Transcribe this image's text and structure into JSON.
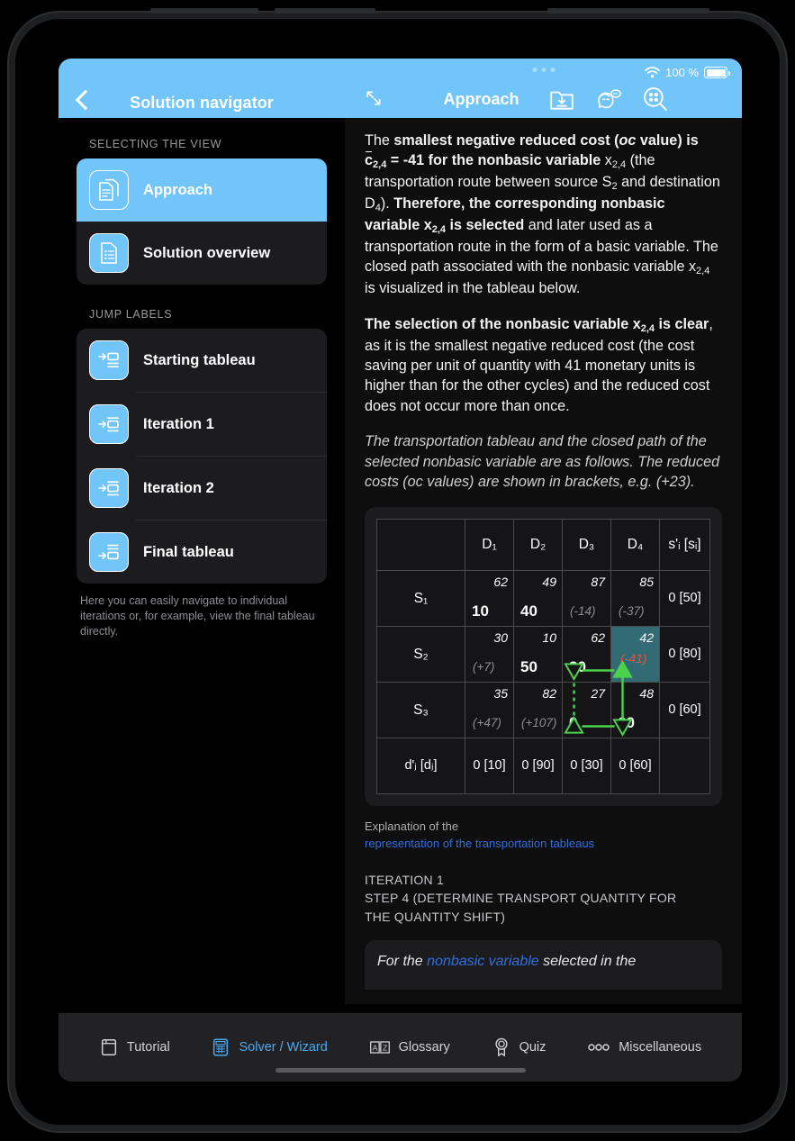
{
  "status": {
    "battery_label": "100 %",
    "wifi_icon": "wifi-icon",
    "battery_icon": "battery-full-icon"
  },
  "nav_left": {
    "title": "Solution navigator",
    "back_icon": "back-chevron-icon"
  },
  "nav_right": {
    "title": "Approach",
    "expand_icon": "expand-diagonal-icon",
    "icons": [
      {
        "name": "download-folder-icon"
      },
      {
        "name": "face-chat-icon"
      },
      {
        "name": "search-dots-icon"
      }
    ]
  },
  "sidebar": {
    "section_view_label": "SELECTING THE VIEW",
    "view_items": [
      {
        "label": "Approach",
        "icon": "documents-icon",
        "selected": true
      },
      {
        "label": "Solution overview",
        "icon": "document-list-icon",
        "selected": false
      }
    ],
    "section_jump_label": "JUMP LABELS",
    "jump_items": [
      {
        "label": "Starting tableau",
        "icon": "jump-top-icon"
      },
      {
        "label": "Iteration 1",
        "icon": "jump-middle-icon"
      },
      {
        "label": "Iteration 2",
        "icon": "jump-middle-icon"
      },
      {
        "label": "Final tableau",
        "icon": "jump-bottom-icon"
      }
    ],
    "hint": "Here you can easily navigate to individual iterations or, for example, view the final tableau directly."
  },
  "content": {
    "paragraph_1_html": "The <b>smallest negative reduced cost (<i>oc</i> value) is <span class=\"ovl\">c</span><sub>2,4</sub> = -41 for the nonbasic variable</span></b> x<sub>2,4</sub> (the transportation route between source S<sub>2</sub> and destination D<sub>4</sub>). <b>Therefore, the corresponding nonbasic variable x<sub>2,4</sub> is selected</b> and later used as a transportation route in the form of a basic variable. The closed path associated with the nonbasic variable x<sub>2,4</sub> is visualized in the tableau below.",
    "paragraph_2_html": "<b>The selection of the nonbasic variable x<sub>2,4</sub> is clear</b>, as it is the smallest negative reduced cost (the cost saving per unit of quantity with 41 monetary units is higher than for the other cycles) and the reduced cost does not occur more than once.",
    "paragraph_3": "The transportation tableau and the closed path of the selected nonbasic variable are as follows. The reduced costs (oc values) are shown in brackets, e.g. (+23).",
    "explanation_prefix": "Explanation of the",
    "explanation_link": "representation of the transportation tableaus",
    "step_head_line1": "ITERATION 1",
    "step_head_line2": "STEP 4 (DETERMINE TRANSPORT QUANTITY FOR",
    "step_head_line3": "THE QUANTITY SHIFT)",
    "next_card_html": "For the <span class=\"lnk\">nonbasic variable</span> selected in the"
  },
  "chart_data": {
    "type": "table",
    "title": "Transportation tableau with closed path",
    "corner_label": "",
    "column_headers": [
      "D₁",
      "D₂",
      "D₃",
      "D₄",
      "s'ᵢ [sᵢ]"
    ],
    "row_headers": [
      "S₁",
      "S₂",
      "S₃"
    ],
    "demand_row_header": "d'ⱼ [dⱼ]",
    "demand_row": [
      "0 [10]",
      "0 [90]",
      "0 [30]",
      "0 [60]"
    ],
    "supplies": [
      "0 [50]",
      "0 [80]",
      "0 [60]"
    ],
    "cells": [
      [
        {
          "cost": "62",
          "value": "10",
          "oc": null,
          "selected": false
        },
        {
          "cost": "49",
          "value": "40",
          "oc": null,
          "selected": false
        },
        {
          "cost": "87",
          "value": null,
          "oc": "(-14)",
          "selected": false
        },
        {
          "cost": "85",
          "value": null,
          "oc": "(-37)",
          "selected": false
        }
      ],
      [
        {
          "cost": "30",
          "value": null,
          "oc": "(+7)",
          "selected": false
        },
        {
          "cost": "10",
          "value": "50",
          "oc": null,
          "selected": false
        },
        {
          "cost": "62",
          "value": "30",
          "oc": null,
          "selected": false
        },
        {
          "cost": "42",
          "value": null,
          "oc": "(-41)",
          "selected": true
        }
      ],
      [
        {
          "cost": "35",
          "value": null,
          "oc": "(+47)",
          "selected": false
        },
        {
          "cost": "82",
          "value": null,
          "oc": "(+107)",
          "selected": false
        },
        {
          "cost": "27",
          "value": "0",
          "oc": null,
          "selected": false
        },
        {
          "cost": "48",
          "value": "60",
          "oc": null,
          "selected": false
        }
      ]
    ],
    "closed_path": {
      "color": "#4cd14c",
      "nodes": [
        {
          "row": "S₂",
          "col": "D₄",
          "marker": "up-triangle"
        },
        {
          "row": "S₃",
          "col": "D₄",
          "marker": "down-triangle"
        },
        {
          "row": "S₃",
          "col": "D₃",
          "marker": "up-triangle"
        },
        {
          "row": "S₂",
          "col": "D₃",
          "marker": "down-triangle"
        }
      ]
    },
    "selected_cell": {
      "row": "S₂",
      "col": "D₄",
      "oc_value": -41,
      "cost": 42
    }
  },
  "tabbar": {
    "items": [
      {
        "label": "Tutorial",
        "icon": "book-icon",
        "active": false
      },
      {
        "label": "Solver / Wizard",
        "icon": "calculator-icon",
        "active": true
      },
      {
        "label": "Glossary",
        "icon": "az-icon",
        "active": false
      },
      {
        "label": "Quiz",
        "icon": "rosette-icon",
        "active": false
      },
      {
        "label": "Miscellaneous",
        "icon": "three-dots-icon",
        "active": false
      }
    ]
  },
  "colors": {
    "accent": "#72c5f8",
    "link": "#2f6fe0",
    "selected_cell": "#336b75",
    "path": "#4cd14c",
    "oc_negative": "#e2533f"
  }
}
